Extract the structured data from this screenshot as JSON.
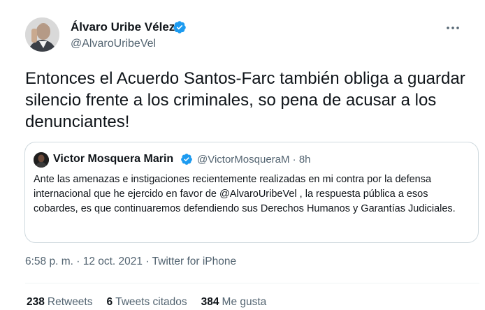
{
  "tweet": {
    "author_name": "Álvaro Uribe Vélez",
    "author_handle": "@AlvaroUribeVel",
    "more_icon": "more-horizontal-icon",
    "text": "Entonces el Acuerdo Santos-Farc también obliga a guardar silencio frente a los criminales, so pena de acusar a los denunciantes!",
    "verified_color": "#1d9bf0"
  },
  "quote": {
    "author_name": "Victor Mosquera Marin",
    "handle_time": "@VictorMosqueraM · 8h",
    "text": "Ante las amenazas e instigaciones recientemente realizadas en mi contra por la defensa internacional que he ejercido en favor de @AlvaroUribeVel , la respuesta pública a esos cobardes, es que continuaremos defendiendo sus Derechos Humanos y Garantías Judiciales."
  },
  "meta": {
    "timestamp_source": "6:58 p. m. · 12 oct. 2021 · Twitter for iPhone"
  },
  "stats": {
    "retweets_count": "238",
    "retweets_label": "Retweets",
    "quotes_count": "6",
    "quotes_label": "Tweets citados",
    "likes_count": "384",
    "likes_label": "Me gusta"
  }
}
